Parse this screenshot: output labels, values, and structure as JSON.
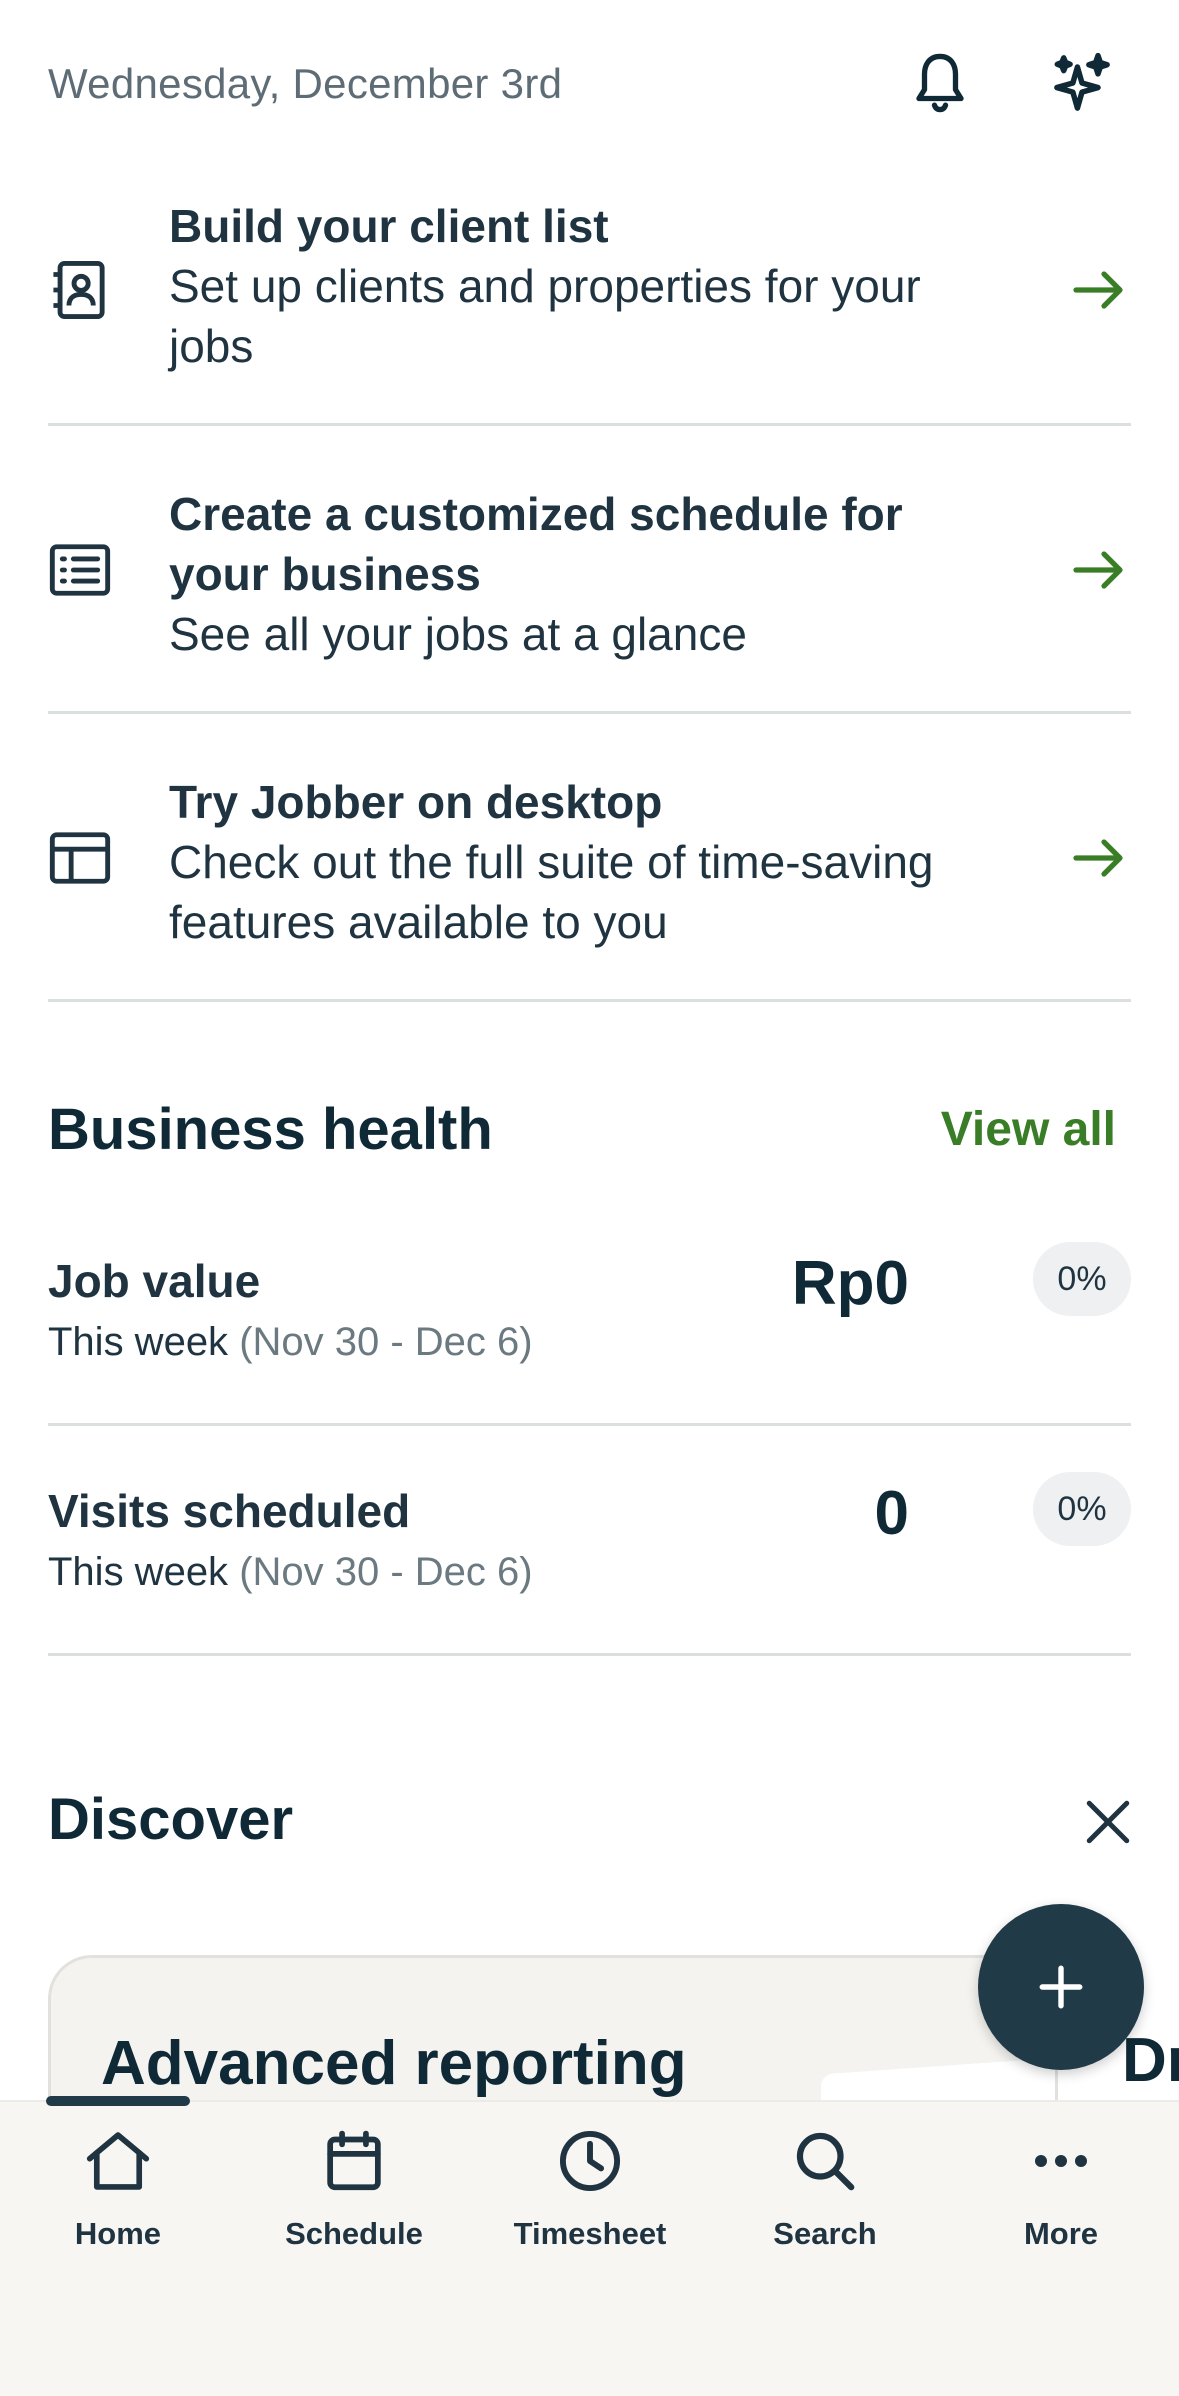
{
  "header": {
    "date": "Wednesday, December 3rd",
    "bell_icon": "bell-icon",
    "sparkle_icon": "sparkle-icon"
  },
  "tasks": [
    {
      "icon": "contact-card-icon",
      "title": "Build your client list",
      "desc_lines": [
        "Set up clients and properties for your",
        "jobs"
      ]
    },
    {
      "icon": "list-icon",
      "title_lines": [
        "Create a customized schedule for",
        "your business"
      ],
      "desc": "See all your jobs at a glance"
    },
    {
      "icon": "desktop-layout-icon",
      "title": "Try Jobber on desktop",
      "desc_lines": [
        "Check out the full suite of time-saving",
        "features available to you"
      ]
    }
  ],
  "business_health": {
    "title": "Business health",
    "view_all": "View all",
    "metrics": [
      {
        "label": "Job value",
        "period": "This week",
        "range": "(Nov 30 - Dec 6)",
        "value": "Rp0",
        "change": "0%"
      },
      {
        "label": "Visits scheduled",
        "period": "This week",
        "range": "(Nov 30 - Dec 6)",
        "value": "0",
        "change": "0%"
      }
    ]
  },
  "discover": {
    "title": "Discover",
    "cards": [
      {
        "title": "Advanced reporting"
      },
      {
        "title": "Dr"
      }
    ]
  },
  "nav": {
    "items": [
      {
        "label": "Home",
        "icon": "home-icon"
      },
      {
        "label": "Schedule",
        "icon": "calendar-icon"
      },
      {
        "label": "Timesheet",
        "icon": "clock-icon"
      },
      {
        "label": "Search",
        "icon": "search-icon"
      },
      {
        "label": "More",
        "icon": "more-icon"
      }
    ]
  },
  "colors": {
    "accent_green": "#3a7d27",
    "dark_navy": "#213a47",
    "text": "#1f3440"
  }
}
